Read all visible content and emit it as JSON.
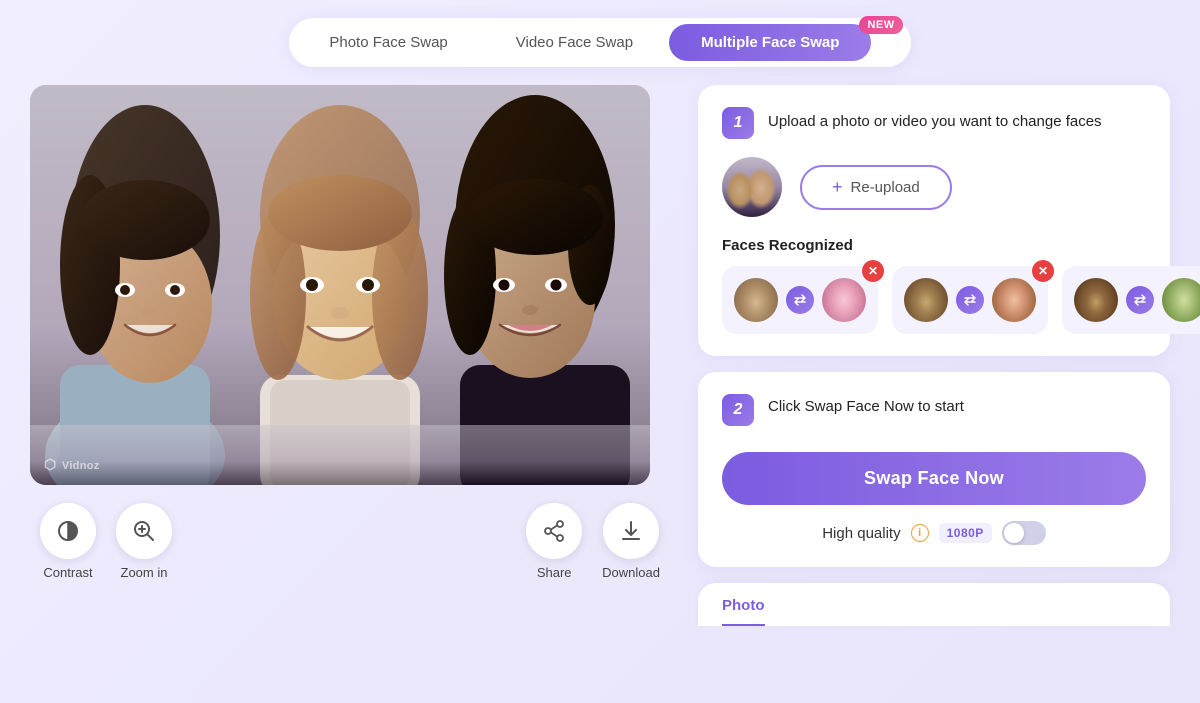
{
  "nav": {
    "tabs": [
      {
        "id": "photo",
        "label": "Photo Face Swap",
        "active": false
      },
      {
        "id": "video",
        "label": "Video Face Swap",
        "active": false
      },
      {
        "id": "multiple",
        "label": "Multiple Face Swap",
        "active": true,
        "badge": "NEW"
      }
    ]
  },
  "step1": {
    "number": "1",
    "title": "Upload a photo or video you want to change faces",
    "reupload_label": "Re-upload",
    "faces_section": "Faces Recognized"
  },
  "step2": {
    "number": "2",
    "title": "Click Swap Face Now to start",
    "swap_btn": "Swap Face Now",
    "quality_label": "High quality",
    "quality_badge": "1080P"
  },
  "controls": {
    "contrast_label": "Contrast",
    "zoomin_label": "Zoom in",
    "share_label": "Share",
    "download_label": "Download"
  },
  "bottom_tab": {
    "label": "Photo"
  },
  "watermark": "Vidnoz"
}
